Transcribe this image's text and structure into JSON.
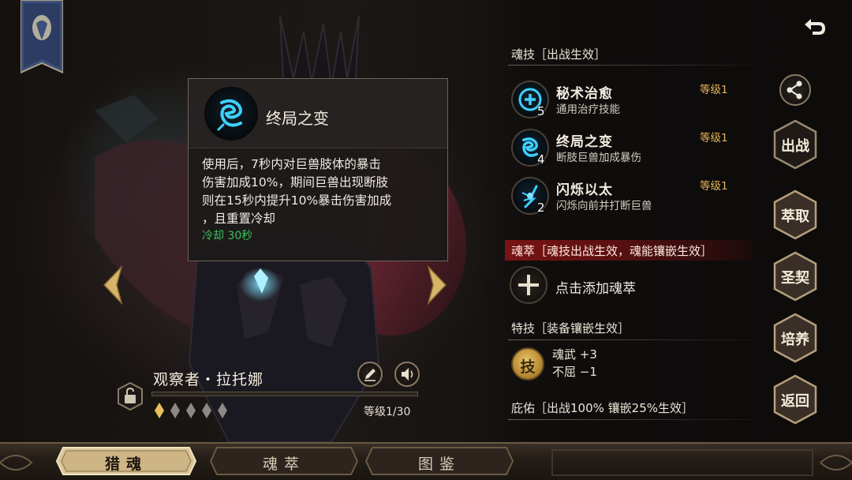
{
  "tooltip": {
    "title": "终局之变",
    "description_lines": [
      "使用后，7秒内对巨兽肢体的暴击",
      "伤害加成10%，期间巨兽出现断肢",
      "则在15秒内提升10%暴击伤害加成",
      "，且重置冷却"
    ],
    "cooldown": "冷却 30秒",
    "cooldown_color": "#38c25a"
  },
  "character": {
    "name": "观察者・拉托娜",
    "level": "等级1/30",
    "stars_filled": 1,
    "stars_total": 5
  },
  "soul_skills": {
    "title": "魂技［出战生效］",
    "items": [
      {
        "name": "秘术治愈",
        "desc": "通用治疗技能",
        "level": "等级1",
        "count": "5",
        "icon": "plus-heal-icon"
      },
      {
        "name": "终局之变",
        "desc": "断肢巨兽加成暴伤",
        "level": "等级1",
        "count": "4",
        "icon": "swirl-rune-icon"
      },
      {
        "name": "闪烁以太",
        "desc": "闪烁向前并打断巨兽",
        "level": "等级1",
        "count": "2",
        "icon": "blink-dash-icon"
      }
    ]
  },
  "soul_essence": {
    "title": "魂萃［魂技出战生效，魂能镶嵌生效］",
    "add_label": "点击添加魂萃"
  },
  "special": {
    "title": "特技［装备镶嵌生效］",
    "icon_glyph": "技",
    "stats": [
      "魂武  +3",
      "不屈  −1"
    ]
  },
  "blessing": {
    "title": "庇佑［出战100% 镶嵌25%生效］"
  },
  "side_buttons": {
    "battle": "出战",
    "extract": "萃取",
    "covenant": "圣契",
    "train": "培养",
    "back": "返回"
  },
  "bottom_tabs": [
    "猎魂",
    "魂萃",
    "图鉴"
  ],
  "active_tab": 0,
  "colors": {
    "accent_gold": "#e3b45a",
    "soul_bar_red": "#7a1414",
    "skill_icon_cyan": "#3fd0ff"
  }
}
